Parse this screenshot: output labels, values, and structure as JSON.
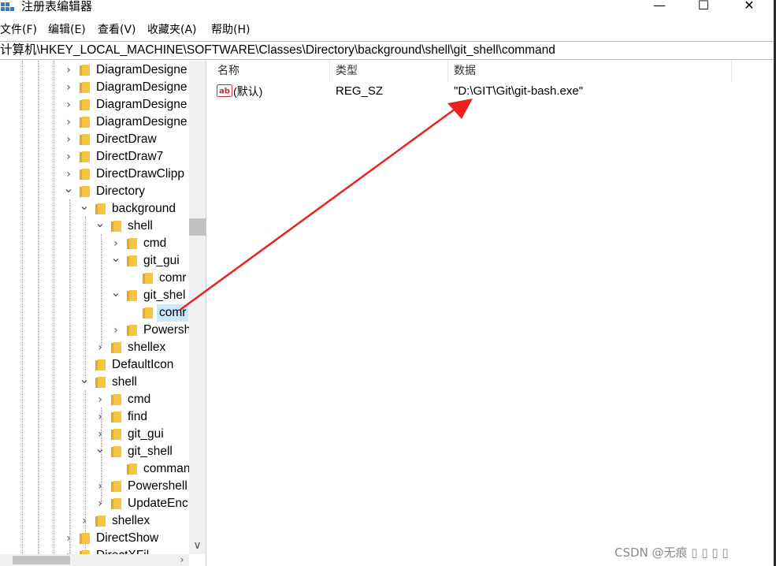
{
  "window": {
    "title": "注册表编辑器",
    "controls": {
      "minimize": "—",
      "maximize": "☐",
      "close": "✕"
    }
  },
  "menu": {
    "file": "文件(F)",
    "edit": "编辑(E)",
    "view": "查看(V)",
    "favorites": "收藏夹(A)",
    "help": "帮助(H)"
  },
  "address": "计算机\\HKEY_LOCAL_MACHINE\\SOFTWARE\\Classes\\Directory\\background\\shell\\git_shell\\command",
  "tree": {
    "nodes": [
      {
        "label": "DiagramDesigne",
        "chevron": ">"
      },
      {
        "label": "DiagramDesigne",
        "chevron": ">"
      },
      {
        "label": "DiagramDesigne",
        "chevron": ">"
      },
      {
        "label": "DiagramDesigne",
        "chevron": ">"
      },
      {
        "label": "DirectDraw",
        "chevron": ">"
      },
      {
        "label": "DirectDraw7",
        "chevron": ">"
      },
      {
        "label": "DirectDrawClipp",
        "chevron": ">"
      },
      {
        "label": "Directory",
        "chevron": "v"
      },
      {
        "label": "background",
        "chevron": "v"
      },
      {
        "label": "shell",
        "chevron": "v"
      },
      {
        "label": "cmd",
        "chevron": ">"
      },
      {
        "label": "git_gui",
        "chevron": "v"
      },
      {
        "label": "comr",
        "chevron": ""
      },
      {
        "label": "git_shel",
        "chevron": "v"
      },
      {
        "label": "comr",
        "chevron": "",
        "selected": true
      },
      {
        "label": "Powersh",
        "chevron": ">"
      },
      {
        "label": "shellex",
        "chevron": ">"
      },
      {
        "label": "DefaultIcon",
        "chevron": ""
      },
      {
        "label": "shell",
        "chevron": "v"
      },
      {
        "label": "cmd",
        "chevron": ">"
      },
      {
        "label": "find",
        "chevron": ">"
      },
      {
        "label": "git_gui",
        "chevron": ">"
      },
      {
        "label": "git_shell",
        "chevron": "v"
      },
      {
        "label": "comman",
        "chevron": ""
      },
      {
        "label": "Powershell",
        "chevron": ">"
      },
      {
        "label": "UpdateEnc",
        "chevron": ">"
      },
      {
        "label": "shellex",
        "chevron": ">"
      },
      {
        "label": "DirectShow",
        "chevron": ">"
      },
      {
        "label": "DirectXFil",
        "chevron": ">"
      }
    ],
    "scroll_down": "∨",
    "scroll_right": "›"
  },
  "values": {
    "headers": {
      "name": "名称",
      "type": "类型",
      "data": "数据"
    },
    "rows": [
      {
        "name": "(默认)",
        "type": "REG_SZ",
        "data": "\"D:\\GIT\\Git\\git-bash.exe\""
      }
    ]
  },
  "watermark": "CSDN @无痕 ▯ ▯ ▯ ▯",
  "colors": {
    "arrow": "#e8231f",
    "selection": "#cce8ff",
    "folder": "#f5c542"
  }
}
